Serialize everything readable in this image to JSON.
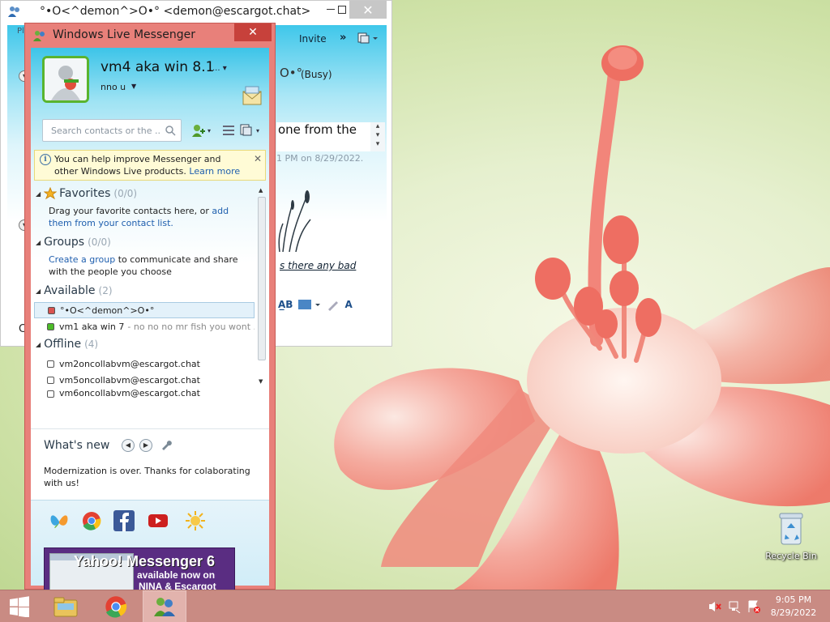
{
  "desktop": {
    "recycle_bin_label": "Recycle Bin"
  },
  "chat_window": {
    "title": "°•O<^demon^>O•° <demon@escargot.chat>",
    "left_partial": "Pl",
    "invite_label": "Invite",
    "more_glyph": "»",
    "contact_status_glyph": "O•°",
    "contact_status": "(Busy)",
    "message_text": "one from the",
    "message_time": "1 PM on 8/29/2022.",
    "input_text": "s there any bad",
    "left_char": "C"
  },
  "messenger": {
    "title": "Windows Live Messenger",
    "close_glyph": "✕",
    "display_name": "vm4 aka win 8.1",
    "display_name_more": "...",
    "personal_message": "nno u",
    "search_placeholder": "Search contacts or the ...",
    "infobar": {
      "text": "You can help improve Messenger and other Windows Live products.",
      "link": "Learn more"
    },
    "groups": [
      {
        "name": "Favorites",
        "count": "(0/0)"
      },
      {
        "name": "Groups",
        "count": "(0/0)"
      },
      {
        "name": "Available",
        "count": "(2)"
      },
      {
        "name": "Offline",
        "count": "(4)"
      }
    ],
    "favorites_text_1": "Drag your favorite contacts here, or",
    "favorites_link": "add them from your contact list.",
    "groups_link": "Create a group",
    "groups_text": "to communicate and share with the people you choose",
    "contacts": [
      {
        "name": "°•O<^demon^>O•°",
        "message": "",
        "status_color": "#d9534f",
        "selected": true
      },
      {
        "name": "vm1 aka win 7",
        "message": "- no no no mr fish you wont ...",
        "status_color": "#4cbb28",
        "selected": false
      },
      {
        "name": "vm2oncollabvm@escargot.chat",
        "message": "",
        "status_color": "#ffffff",
        "selected": false
      },
      {
        "name": "vm5oncollabvm@escargot.chat",
        "message": "",
        "status_color": "#ffffff",
        "selected": false
      },
      {
        "name": "vm6oncollabvm@escargot.chat",
        "message": "",
        "status_color": "#ffffff",
        "selected": false
      }
    ],
    "whats_new_title": "What's new",
    "whats_new_text": "Modernization is over. Thanks for colaborating with us!",
    "ad": {
      "line1": "Yahoo! Messenger 6",
      "line2": "available now on",
      "line3": "NINA & Escargot"
    }
  },
  "taskbar": {
    "time": "9:05 PM",
    "date": "8/29/2022"
  },
  "colors": {
    "messenger_frame": "#e8807a",
    "taskbar": "#c98b83",
    "available": "#4cbb28",
    "busy": "#d9534f",
    "link": "#1f5fae"
  }
}
